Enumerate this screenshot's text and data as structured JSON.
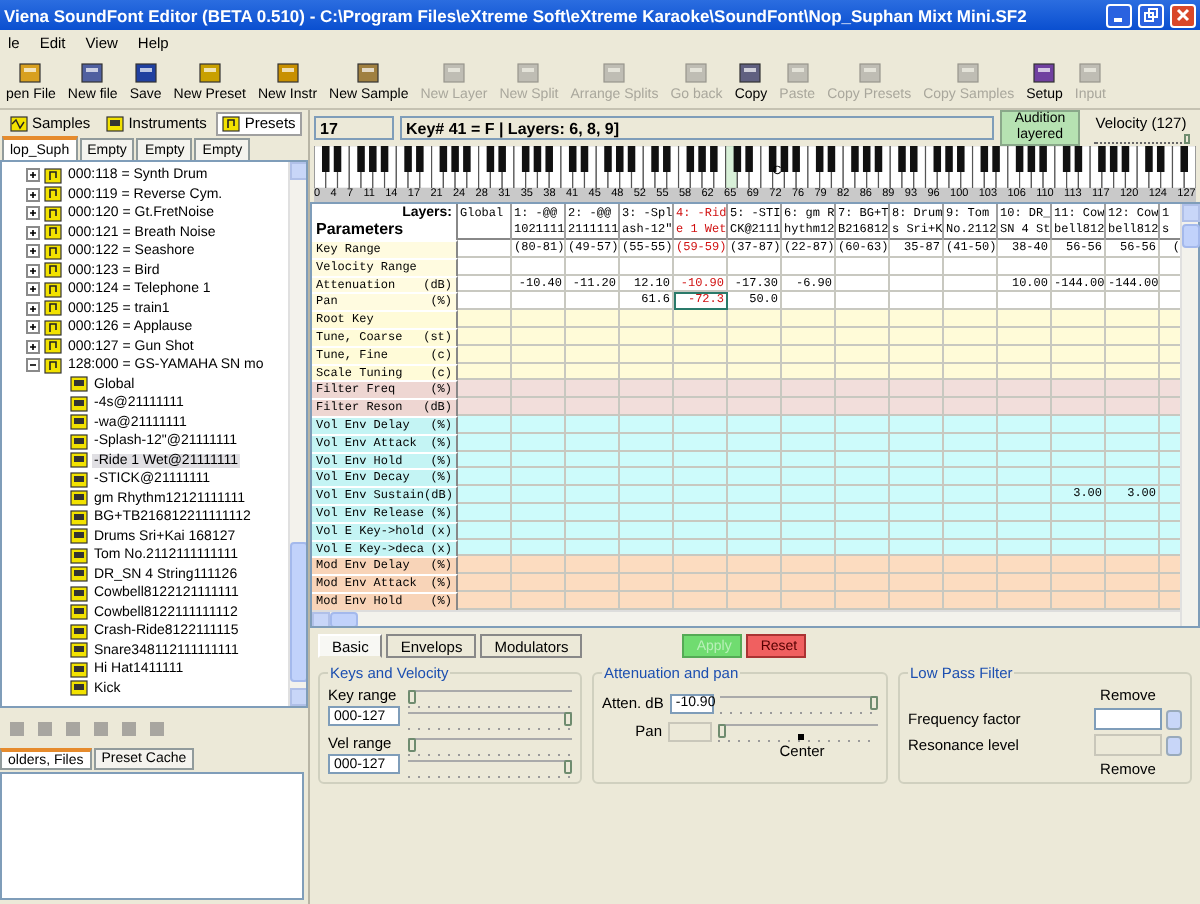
{
  "window": {
    "title": "Viena SoundFont Editor (BETA 0.510) - C:\\Program Files\\eXtreme Soft\\eXtreme Karaoke\\SoundFont\\Nop_Suphan Mixt  Mini.SF2"
  },
  "menu": [
    "le",
    "Edit",
    "View",
    "Help"
  ],
  "toolbar": [
    {
      "label": "pen File",
      "disabled": false
    },
    {
      "label": "New file",
      "disabled": false
    },
    {
      "label": "Save",
      "disabled": false
    },
    {
      "label": "New Preset",
      "disabled": false
    },
    {
      "label": "New Instr",
      "disabled": false
    },
    {
      "label": "New Sample",
      "disabled": false
    },
    {
      "label": "New Layer",
      "disabled": true
    },
    {
      "label": "New Split",
      "disabled": true
    },
    {
      "label": "Arrange Splits",
      "disabled": true
    },
    {
      "label": "Go back",
      "disabled": true
    },
    {
      "label": "Copy",
      "disabled": false
    },
    {
      "label": "Paste",
      "disabled": true
    },
    {
      "label": "Copy Presets",
      "disabled": true
    },
    {
      "label": "Copy Samples",
      "disabled": true
    },
    {
      "label": "Setup",
      "disabled": false
    },
    {
      "label": "Input",
      "disabled": true
    }
  ],
  "left_panel": {
    "view_tabs": [
      {
        "label": "Samples",
        "selected": false
      },
      {
        "label": "Instruments",
        "selected": false
      },
      {
        "label": "Presets",
        "selected": true
      }
    ],
    "file_tabs": [
      {
        "label": "lop_Suph",
        "selected": true
      },
      {
        "label": "Empty",
        "selected": false
      },
      {
        "label": "Empty",
        "selected": false
      },
      {
        "label": "Empty",
        "selected": false
      }
    ],
    "tree": [
      {
        "label": "000:118 = Synth Drum",
        "expanded": false
      },
      {
        "label": "000:119 = Reverse Cym.",
        "expanded": false
      },
      {
        "label": "000:120 = Gt.FretNoise",
        "expanded": false
      },
      {
        "label": "000:121 = Breath Noise",
        "expanded": false
      },
      {
        "label": "000:122 = Seashore",
        "expanded": false
      },
      {
        "label": "000:123 = Bird",
        "expanded": false
      },
      {
        "label": "000:124 = Telephone 1",
        "expanded": false
      },
      {
        "label": "000:125 = train1",
        "expanded": false
      },
      {
        "label": "000:126 = Applause",
        "expanded": false
      },
      {
        "label": "000:127 = Gun Shot",
        "expanded": false
      },
      {
        "label": "128:000 = GS-YAMAHA SN mo",
        "expanded": true,
        "children": [
          {
            "label": "Global",
            "selected": false
          },
          {
            "label": "-4s@21111111",
            "selected": false
          },
          {
            "label": "-wa@21111111",
            "selected": false
          },
          {
            "label": "-Splash-12\"@21111111",
            "selected": false
          },
          {
            "label": "-Ride 1 Wet@21111111",
            "selected": true
          },
          {
            "label": "-STICK@21111111",
            "selected": false
          },
          {
            "label": "gm Rhythm12121111111",
            "selected": false
          },
          {
            "label": "BG+TB216812211111112",
            "selected": false
          },
          {
            "label": "Drums Sri+Kai 168127",
            "selected": false
          },
          {
            "label": "Tom No.2112111111111",
            "selected": false
          },
          {
            "label": "DR_SN 4 String111126",
            "selected": false
          },
          {
            "label": "Cowbell8122121111111",
            "selected": false
          },
          {
            "label": "Cowbell8122111111112",
            "selected": false
          },
          {
            "label": "Crash-Ride8122111115",
            "selected": false
          },
          {
            "label": "Snare348112111111111",
            "selected": false
          },
          {
            "label": "Hi Hat1411111",
            "selected": false
          },
          {
            "label": "Kick",
            "selected": false
          }
        ]
      }
    ],
    "bottom_tabs": [
      {
        "label": "olders, Files",
        "selected": true
      },
      {
        "label": "Preset Cache",
        "selected": false
      }
    ]
  },
  "editor": {
    "preset_number": "17",
    "key_info": "Key# 41 = F | Layers: 6, 8, 9]",
    "audition_button": {
      "label": "Audition layered",
      "on": true
    },
    "velocity": {
      "label": "Velocity (127)",
      "level": 1
    },
    "keyboard": {
      "labels": [
        "0",
        "4",
        "7",
        "11",
        "14",
        "17",
        "21",
        "24",
        "28",
        "31",
        "35",
        "38",
        "41",
        "45",
        "48",
        "52",
        "55",
        "58",
        "62",
        "65",
        "69",
        "72",
        "76",
        "79",
        "82",
        "86",
        "89",
        "93",
        "96",
        "100",
        "103",
        "106",
        "110",
        "113",
        "117",
        "120",
        "124",
        "127"
      ],
      "middle_c_label": "C"
    },
    "grid": {
      "corner_title": "Parameters",
      "corner_layers": "Layers:",
      "columns": [
        {
          "lines": [
            "Global"
          ],
          "selected": false
        },
        {
          "lines": [
            "1: -@@",
            "1021111"
          ],
          "selected": false
        },
        {
          "lines": [
            "2: -@@",
            "2111111"
          ],
          "selected": false
        },
        {
          "lines": [
            "3: -Spl",
            "ash-12\""
          ],
          "selected": false
        },
        {
          "lines": [
            "4: -Rid",
            "e 1 Wet"
          ],
          "selected": true
        },
        {
          "lines": [
            "5: -STI",
            "CK@2111"
          ],
          "selected": false
        },
        {
          "lines": [
            "6: gm R",
            "hythm12"
          ],
          "selected": false
        },
        {
          "lines": [
            "7: BG+T",
            "B216812"
          ],
          "selected": false
        },
        {
          "lines": [
            "8: Drum",
            "s Sri+K"
          ],
          "selected": false
        },
        {
          "lines": [
            "9: Tom",
            "No.2112"
          ],
          "selected": false
        },
        {
          "lines": [
            "10: DR_",
            "SN 4 St"
          ],
          "selected": false
        },
        {
          "lines": [
            "11: Cow",
            "bell812"
          ],
          "selected": false
        },
        {
          "lines": [
            "12: Cow",
            "bell812"
          ],
          "selected": false
        },
        {
          "lines": [
            "1",
            "s"
          ],
          "selected": false
        }
      ],
      "rows": [
        {
          "name": "Key Range",
          "kind": "general",
          "selected": false,
          "cells": [
            null,
            "(80-81)",
            "(49-57)",
            "(55-55)",
            "(59-59)",
            "(37-87)",
            "(22-87)",
            "(60-63)",
            "35-87",
            "(41-50)",
            "38-40",
            "56-56",
            "56-56",
            "("
          ]
        },
        {
          "name": "Velocity Range",
          "kind": "general",
          "selected": false
        },
        {
          "name": "Attenuation",
          "unit": "(dB)",
          "kind": "general",
          "selected": false,
          "cells": [
            null,
            "-10.40",
            "-11.20",
            "12.10",
            "-10.90",
            "-17.30",
            "-6.90",
            null,
            null,
            null,
            "10.00",
            "-144.00",
            "-144.00",
            null
          ]
        },
        {
          "name": "Pan",
          "unit": "(%)",
          "kind": "general",
          "selected": true,
          "cells": [
            null,
            null,
            null,
            "61.6",
            "-72.3",
            "50.0",
            null,
            null,
            null,
            null,
            null,
            null,
            null,
            null
          ]
        },
        {
          "name": "Root Key",
          "kind": "tuning",
          "selected": false
        },
        {
          "name": "Tune, Coarse",
          "unit": "(st)",
          "kind": "tuning",
          "selected": false
        },
        {
          "name": "Tune, Fine",
          "unit": "(c)",
          "kind": "tuning",
          "selected": false
        },
        {
          "name": "Scale Tuning",
          "unit": "(c)",
          "kind": "tuning",
          "selected": false
        },
        {
          "name": "Filter Freq",
          "unit": "(%)",
          "kind": "filter",
          "selected": false
        },
        {
          "name": "Filter Reson",
          "unit": "(dB)",
          "kind": "filter",
          "selected": false
        },
        {
          "name": "Vol Env Delay",
          "unit": "(%)",
          "kind": "vol_env",
          "selected": false
        },
        {
          "name": "Vol Env Attack",
          "unit": "(%)",
          "kind": "vol_env",
          "selected": false
        },
        {
          "name": "Vol Env Hold",
          "unit": "(%)",
          "kind": "vol_env",
          "selected": false
        },
        {
          "name": "Vol Env Decay",
          "unit": "(%)",
          "kind": "vol_env",
          "selected": false
        },
        {
          "name": "Vol Env Sustain",
          "unit": "(dB)",
          "kind": "vol_env",
          "selected": false,
          "cells": [
            null,
            null,
            null,
            null,
            null,
            null,
            null,
            null,
            null,
            null,
            null,
            "3.00",
            "3.00",
            null
          ]
        },
        {
          "name": "Vol Env Release",
          "unit": "(%)",
          "kind": "vol_env",
          "selected": false
        },
        {
          "name": "Vol E Key->hold",
          "unit": "(x)",
          "kind": "vol_env",
          "selected": false
        },
        {
          "name": "Vol E Key->deca",
          "unit": "(x)",
          "kind": "vol_env",
          "selected": false
        },
        {
          "name": "Mod Env Delay",
          "unit": "(%)",
          "kind": "mod_env",
          "selected": false
        },
        {
          "name": "Mod Env Attack",
          "unit": "(%)",
          "kind": "mod_env",
          "selected": false
        },
        {
          "name": "Mod Env Hold",
          "unit": "(%)",
          "kind": "mod_env",
          "selected": false
        }
      ]
    },
    "tabs": [
      {
        "label": "Basic",
        "selected": true
      },
      {
        "label": "Envelops",
        "selected": false
      },
      {
        "label": "Modulators",
        "selected": false
      }
    ],
    "apply_button": {
      "label": "Apply",
      "disabled": true
    },
    "reset_button": {
      "label": "Reset"
    },
    "keys_velocity": {
      "title": "Keys and Velocity",
      "key_range": {
        "label": "Key range",
        "value": "000-127",
        "sliders": [
          {
            "level": 0
          },
          {
            "level": 1
          }
        ]
      },
      "vel_range": {
        "label": "Vel range",
        "value": "000-127",
        "sliders": [
          {
            "level": 0
          },
          {
            "level": 1
          }
        ]
      }
    },
    "attenuation_pan": {
      "title": "Attenuation and pan",
      "attenuation": {
        "label": "Atten. dB",
        "value": "-10.90",
        "level": 1
      },
      "pan": {
        "label": "Pan",
        "disabled": true,
        "level": 0,
        "center_label": "Center"
      }
    },
    "low_pass": {
      "title": "Low Pass Filter",
      "remove_top": "Remove",
      "frequency": {
        "label": "Frequency factor",
        "disabled": false
      },
      "resonance": {
        "label": "Resonance level",
        "disabled": true
      },
      "remove_bottom": "Remove"
    }
  }
}
